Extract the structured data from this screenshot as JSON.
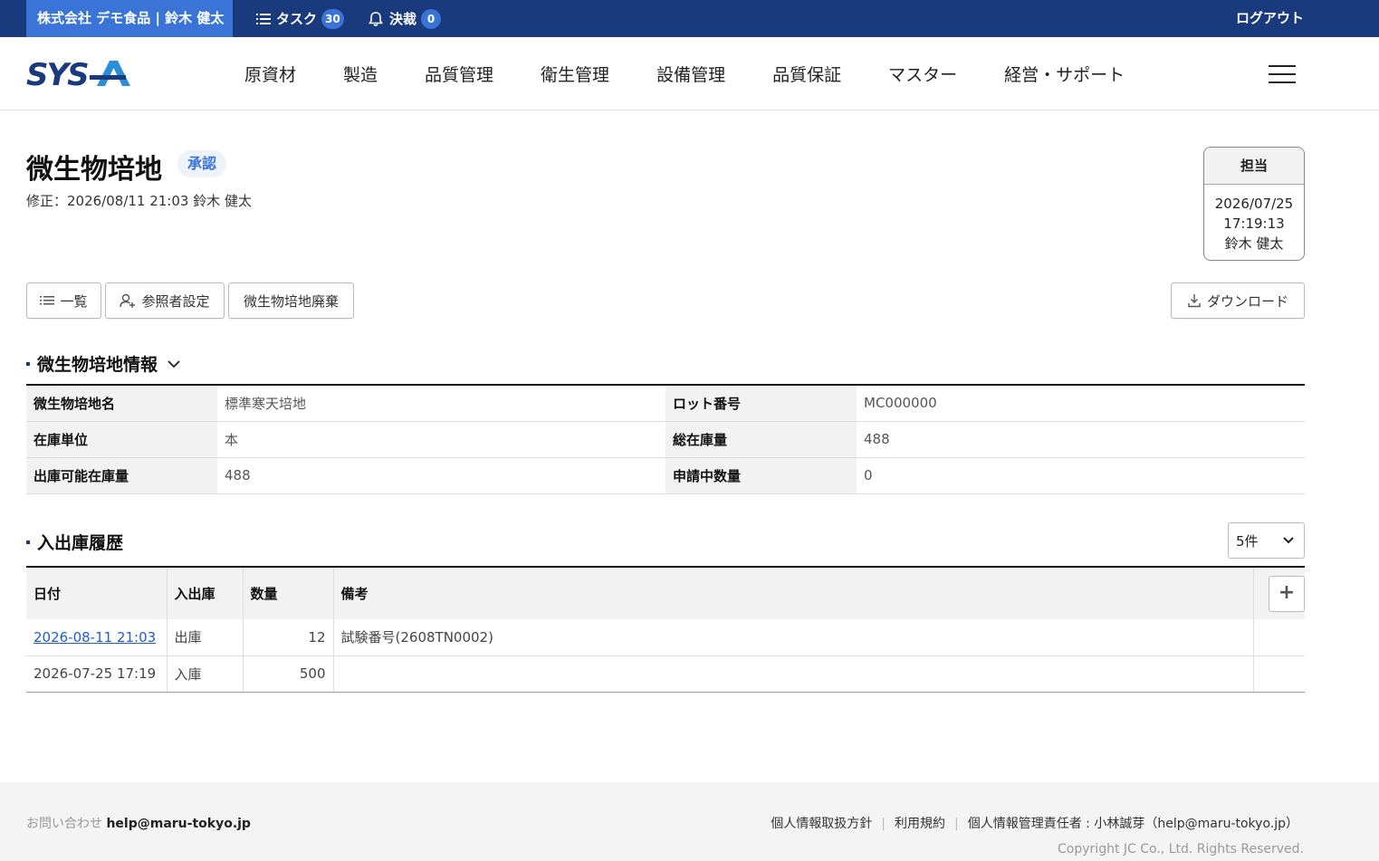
{
  "topbar": {
    "company_user": "株式会社 デモ食品 | 鈴木 健太",
    "task_label": "タスク",
    "task_count": "30",
    "approval_label": "決裁",
    "approval_count": "0",
    "logout": "ログアウト"
  },
  "header": {
    "logo": "SYSA",
    "nav": [
      "原資材",
      "製造",
      "品質管理",
      "衛生管理",
      "設備管理",
      "品質保証",
      "マスター",
      "経営・サポート"
    ]
  },
  "page": {
    "title": "微生物培地",
    "status": "承認",
    "modified": "修正：2026/08/11 21:03  鈴木 健太"
  },
  "assignee": {
    "label": "担当",
    "date": "2026/07/25",
    "time": "17:19:13",
    "name": "鈴木 健太"
  },
  "buttons": {
    "list": "一覧",
    "viewer_settings": "参照者設定",
    "dispose": "微生物培地廃棄",
    "download": "ダウンロード"
  },
  "info_section": {
    "title": "微生物培地情報",
    "rows": [
      {
        "label1": "微生物培地名",
        "value1": "標準寒天培地",
        "label2": "ロット番号",
        "value2": "MC000000"
      },
      {
        "label1": "在庫単位",
        "value1": "本",
        "label2": "総在庫量",
        "value2": "488"
      },
      {
        "label1": "出庫可能在庫量",
        "value1": "488",
        "label2": "申請中数量",
        "value2": "0"
      }
    ]
  },
  "history_section": {
    "title": "入出庫履歴",
    "page_size": "5件",
    "columns": [
      "日付",
      "入出庫",
      "数量",
      "備考"
    ],
    "rows": [
      {
        "date": "2026-08-11 21:03",
        "type": "出庫",
        "qty": "12",
        "note": "試験番号(2608TN0002)"
      },
      {
        "date": "2026-07-25 17:19",
        "type": "入庫",
        "qty": "500",
        "note": ""
      }
    ]
  },
  "footer": {
    "contact_label": "お問い合わせ",
    "contact_email": "help@maru-tokyo.jp",
    "links": [
      "個人情報取扱方針",
      "利用規約",
      "個人情報管理責任者 : 小林誠芽（help@maru-tokyo.jp）"
    ],
    "copyright": "Copyright JC Co., Ltd. Rights Reserved."
  },
  "colors": {
    "topbar": "#1a3a7e",
    "accent": "#3a74d6",
    "link": "#1f5ccf"
  }
}
